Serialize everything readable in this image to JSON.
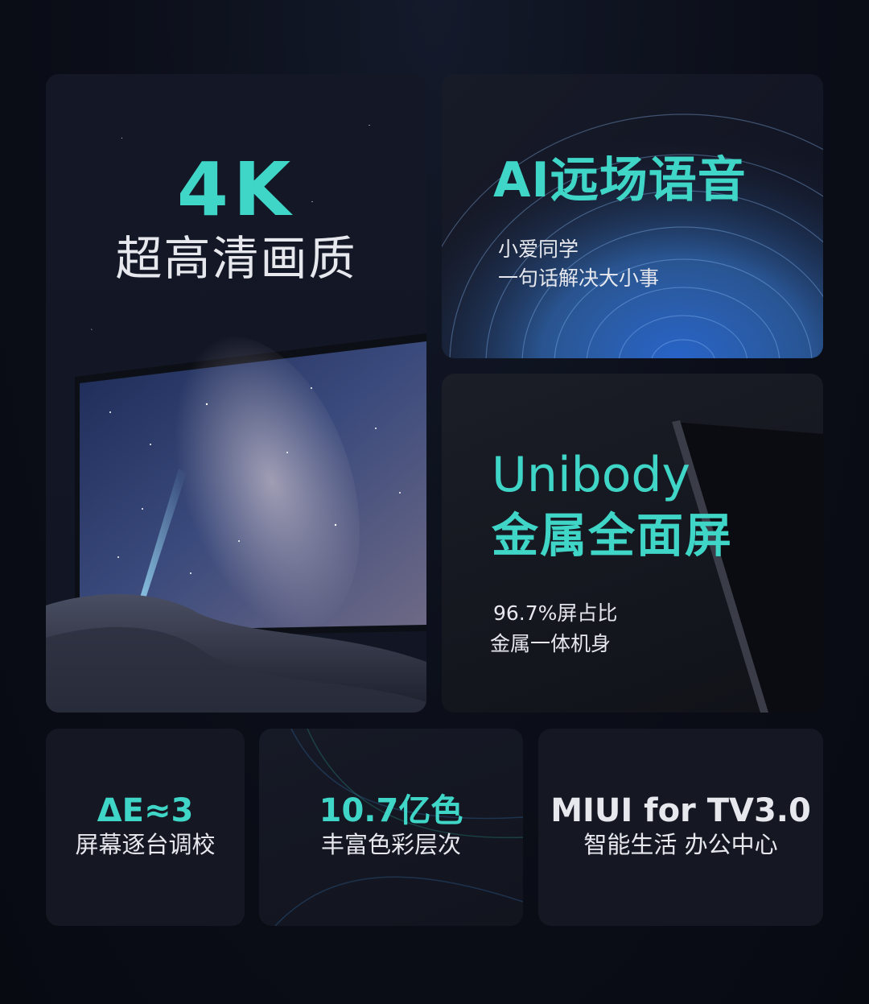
{
  "card_4k": {
    "title": "4K",
    "subtitle": "超高清画质"
  },
  "card_ai": {
    "title": "AI远场语音",
    "lines": [
      "小爱同学",
      "一句话解决大小事"
    ]
  },
  "card_unibody": {
    "title_en": "Unibody",
    "title_cn": "金属全面屏",
    "lines": [
      "96.7%屏占比",
      "金属一体机身"
    ]
  },
  "card_delta": {
    "title": "ΔE≈3",
    "subtitle": "屏幕逐台调校"
  },
  "card_colors": {
    "title": "10.7亿色",
    "subtitle": "丰富色彩层次"
  },
  "card_miui": {
    "title": "MIUI for TV3.0",
    "subtitle": "智能生活 办公中心"
  },
  "colors": {
    "accent": "#3fd6c8",
    "text": "#e6e8ee",
    "card_bg": "#151722",
    "page_bg": "#0b0e18"
  }
}
